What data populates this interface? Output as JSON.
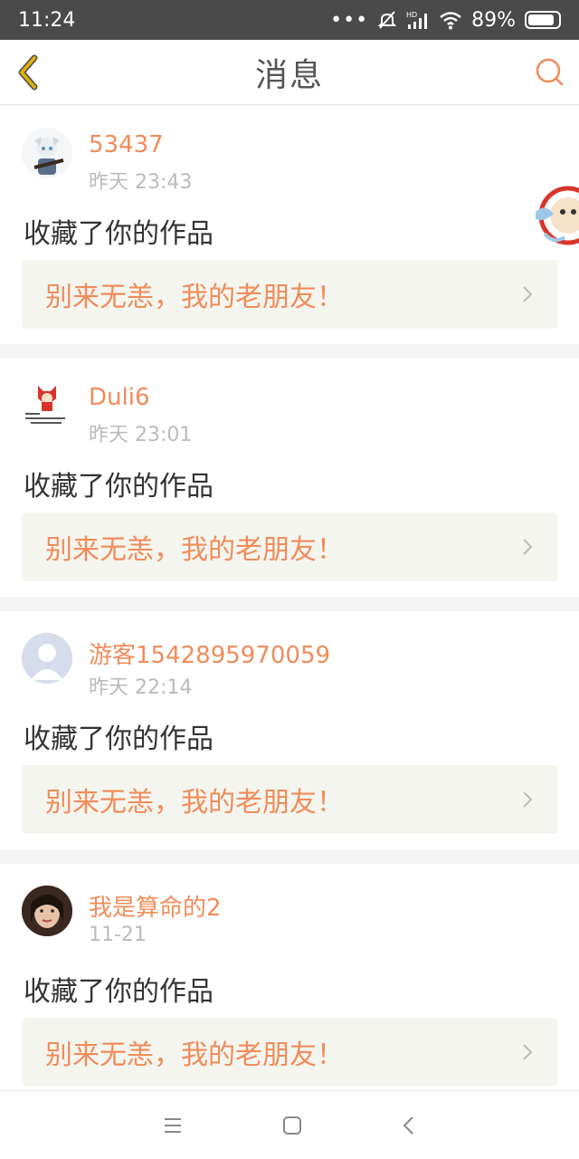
{
  "status_bar": {
    "time": "11:24",
    "dots": "•••",
    "battery": "89%",
    "battery_level": 0.89
  },
  "header": {
    "title": "消息",
    "back_icon": "back-chevron-icon",
    "search_icon": "search-icon"
  },
  "messages": [
    {
      "username": "53437",
      "time": "昨天 23:43",
      "action": "收藏了你的作品",
      "quote": "别来无恙，我的老朋友！"
    },
    {
      "username": "Duli6",
      "time": "昨天 23:01",
      "action": "收藏了你的作品",
      "quote": "别来无恙，我的老朋友！"
    },
    {
      "username": "游客1542895970059",
      "time": "昨天 22:14",
      "action": "收藏了你的作品",
      "quote": "别来无恙，我的老朋友！"
    },
    {
      "username": "我是算命的2",
      "time": "11-21",
      "action": "收藏了你的作品",
      "quote": "别来无恙，我的老朋友！"
    }
  ],
  "colors": {
    "accent": "#f08c5a",
    "status_bar_bg": "#4a4a4a",
    "quote_bg": "#f5f5ef",
    "back_icon": "#e2b400"
  }
}
